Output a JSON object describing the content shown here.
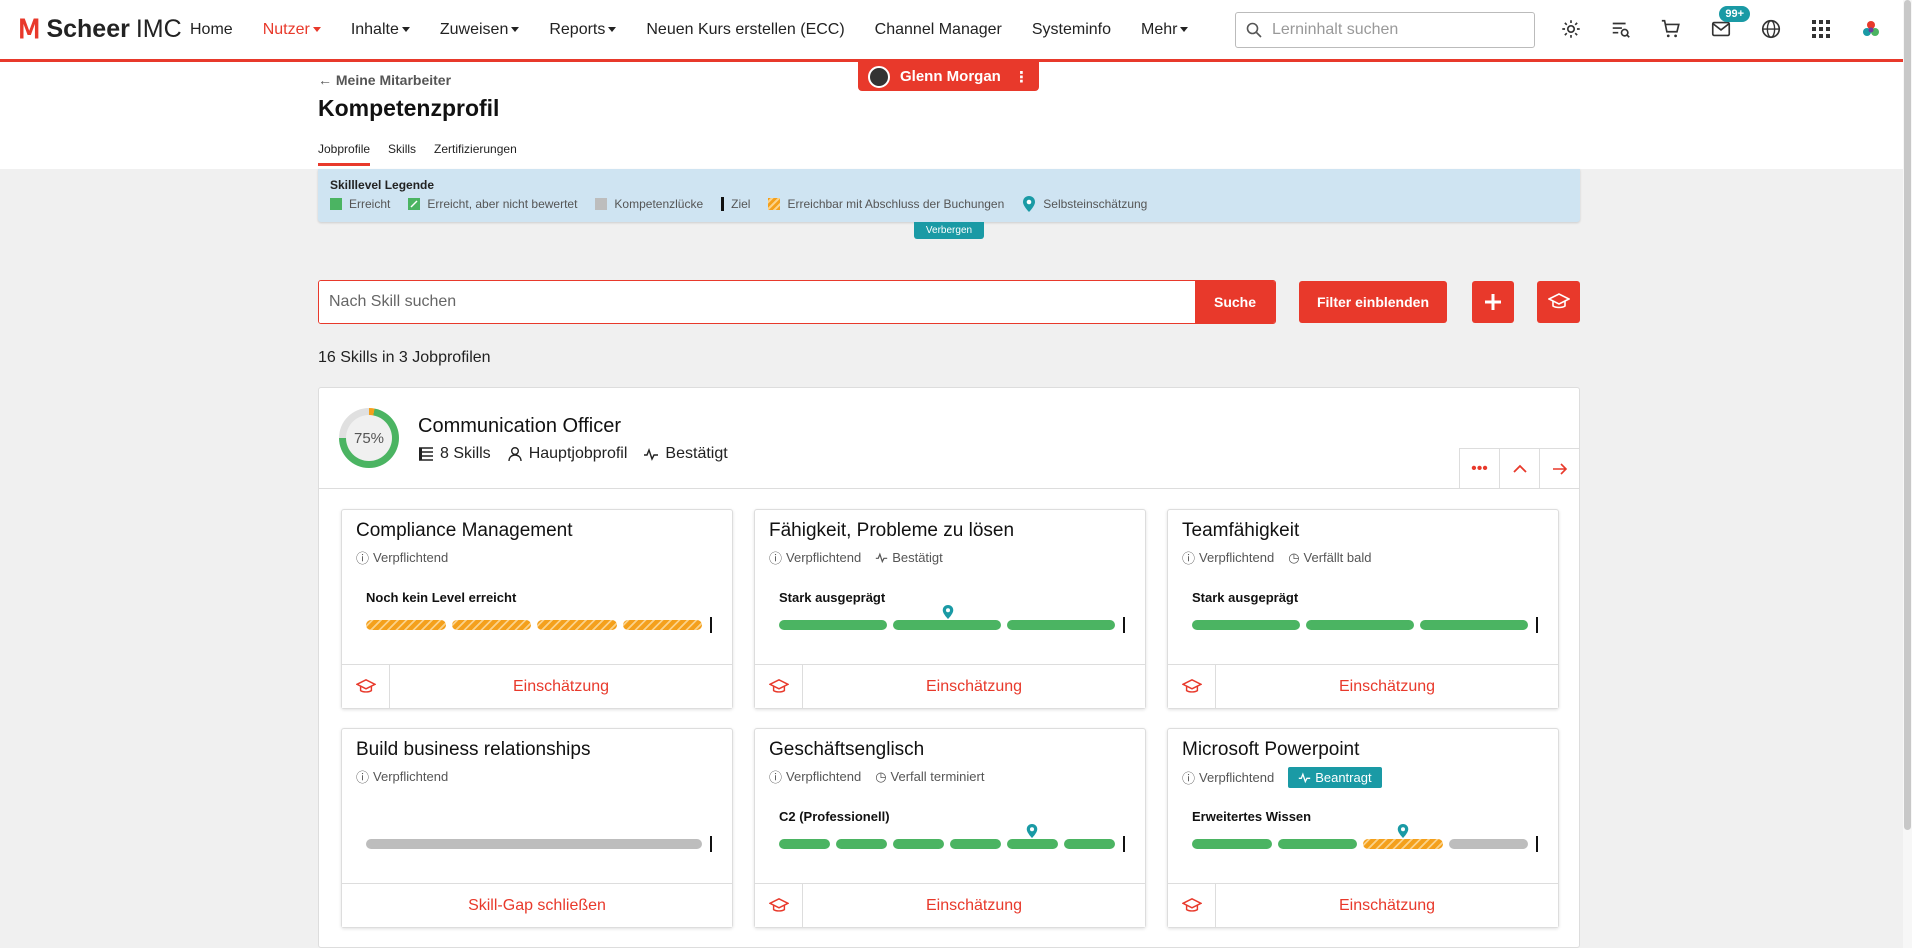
{
  "brand": {
    "name_bold": "Scheer",
    "name_light": "IMC"
  },
  "nav": {
    "items": [
      {
        "label": "Home",
        "dropdown": false,
        "active": false
      },
      {
        "label": "Nutzer",
        "dropdown": true,
        "active": true
      },
      {
        "label": "Inhalte",
        "dropdown": true,
        "active": false
      },
      {
        "label": "Zuweisen",
        "dropdown": true,
        "active": false
      },
      {
        "label": "Reports",
        "dropdown": true,
        "active": false
      },
      {
        "label": "Neuen Kurs erstellen (ECC)",
        "dropdown": false,
        "active": false
      },
      {
        "label": "Channel Manager",
        "dropdown": false,
        "active": false
      },
      {
        "label": "Systeminfo",
        "dropdown": false,
        "active": false
      },
      {
        "label": "Mehr",
        "dropdown": true,
        "active": false
      }
    ],
    "search_placeholder": "Lerninhalt suchen",
    "mail_badge": "99+"
  },
  "header": {
    "back_link": "Meine Mitarbeiter",
    "title": "Kompetenzprofil",
    "tabs": [
      "Jobprofile",
      "Skills",
      "Zertifizierungen"
    ],
    "user_name": "Glenn Morgan"
  },
  "legend": {
    "title": "Skilllevel Legende",
    "items": [
      "Erreicht",
      "Erreicht, aber nicht bewertet",
      "Kompetenzlücke",
      "Ziel",
      "Erreichbar mit Abschluss der Buchungen",
      "Selbsteinschätzung"
    ],
    "hide_label": "Verbergen"
  },
  "search": {
    "placeholder": "Nach Skill suchen",
    "button": "Suche",
    "filter_button": "Filter einblenden"
  },
  "result_count": "16 Skills in 3 Jobprofilen",
  "jobprofile": {
    "progress": 75,
    "progress_label": "75%",
    "name": "Communication Officer",
    "skills": "8 Skills",
    "type": "Hauptjobprofil",
    "status": "Bestätigt"
  },
  "cards": [
    {
      "title": "Compliance Management",
      "tags": [
        "Verpflichtend"
      ],
      "level": "Noch kein Level erreicht",
      "action": "Einschätzung"
    },
    {
      "title": "Fähigkeit, Probleme zu lösen",
      "tags": [
        "Verpflichtend",
        "Bestätigt"
      ],
      "level": "Stark ausgeprägt",
      "action": "Einschätzung"
    },
    {
      "title": "Teamfähigkeit",
      "tags": [
        "Verpflichtend",
        "Verfällt bald"
      ],
      "level": "Stark ausgeprägt",
      "action": "Einschätzung"
    },
    {
      "title": "Build business relationships",
      "tags": [
        "Verpflichtend"
      ],
      "level": "",
      "action": "Skill-Gap schließen"
    },
    {
      "title": "Geschäftsenglisch",
      "tags": [
        "Verpflichtend",
        "Verfall terminiert"
      ],
      "level": "C2 (Professionell)",
      "action": "Einschätzung"
    },
    {
      "title": "Microsoft Powerpoint",
      "tags": [
        "Verpflichtend",
        "Beantragt"
      ],
      "level": "Erweitertes Wissen",
      "action": "Einschätzung"
    }
  ],
  "colors": {
    "accent": "#e8392b",
    "teal": "#1a9aa5",
    "achieved": "#4bb462",
    "gap": "#bdbdbd",
    "reachable": "#f4a01c"
  }
}
